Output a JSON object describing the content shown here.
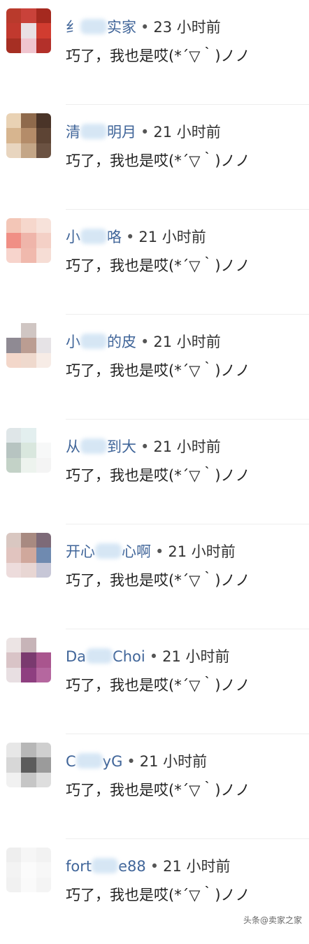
{
  "comments": [
    {
      "name_visible_start": "纟",
      "name_visible_end": "实家",
      "dot": "•",
      "time": "23 小时前",
      "text": "巧了，我也是哎(*´▽｀)ノノ",
      "avatar_colors": [
        "#b93a2c",
        "#c9423a",
        "#a5291f",
        "#c1392e",
        "#e9e0e4",
        "#d13c30",
        "#a62f23",
        "#f0c5cf",
        "#b3302a"
      ]
    },
    {
      "name_visible_start": "清",
      "name_visible_end": "明月",
      "dot": "•",
      "time": "21 小时前",
      "text": "巧了，我也是哎(*´▽｀)ノノ",
      "avatar_colors": [
        "#e9d2b4",
        "#8f6a4c",
        "#4a3428",
        "#d7b58f",
        "#b48c69",
        "#5d4434",
        "#e8d5bf",
        "#c4a687",
        "#6b5242"
      ]
    },
    {
      "name_visible_start": "小",
      "name_visible_end": "咯",
      "dot": "•",
      "time": "21 小时前",
      "text": "巧了，我也是哎(*´▽｀)ノノ",
      "avatar_colors": [
        "#f3c6b7",
        "#f6d7cc",
        "#f7e2da",
        "#f08f85",
        "#efb5aa",
        "#f4d0c6",
        "#f7d4cc",
        "#f0b9ad",
        "#f6ddd5"
      ]
    },
    {
      "name_visible_start": "小",
      "name_visible_end": "的皮",
      "dot": "•",
      "time": "21 小时前",
      "text": "巧了，我也是哎(*´▽｀)ノノ",
      "avatar_colors": [
        "#ffffff",
        "#d0c6c3",
        "#ffffff",
        "#8f8a93",
        "#bb9d92",
        "#e6e3e6",
        "#f3d7ca",
        "#efd9cd",
        "#f7ece6"
      ]
    },
    {
      "name_visible_start": "从",
      "name_visible_end": "到大",
      "dot": "•",
      "time": "21 小时前",
      "text": "巧了，我也是哎(*´▽｀)ノノ",
      "avatar_colors": [
        "#dfe6e8",
        "#e3efef",
        "#ffffff",
        "#b7c4c1",
        "#d9e7de",
        "#f7f8f8",
        "#c3d2c7",
        "#edf3ee",
        "#f4f4f4"
      ]
    },
    {
      "name_visible_start": "开心",
      "name_visible_end": "心啊",
      "dot": "•",
      "time": "21 小时前",
      "text": "巧了，我也是哎(*´▽｀)ノノ",
      "avatar_colors": [
        "#d9c7c1",
        "#a88a81",
        "#7d6a78",
        "#e1c4bf",
        "#d0a89c",
        "#6f8ab0",
        "#eddcdc",
        "#e8d6d3",
        "#c7c7d7"
      ]
    },
    {
      "name_visible_start": "Da",
      "name_visible_end": "Choi",
      "dot": "•",
      "time": "21 小时前",
      "text": "巧了，我也是哎(*´▽｀)ノノ",
      "avatar_colors": [
        "#ece4e4",
        "#c7b4b8",
        "#ffffff",
        "#d9c4c7",
        "#7a3a6f",
        "#a9558e",
        "#e8dfe2",
        "#8e3f80",
        "#b5679f"
      ]
    },
    {
      "name_visible_start": "C",
      "name_visible_end": "yG",
      "dot": "•",
      "time": "21 小时前",
      "text": "巧了，我也是哎(*´▽｀)ノノ",
      "avatar_colors": [
        "#e7e7e7",
        "#b7b7b7",
        "#cfcfcf",
        "#d7d7d7",
        "#5c5c5c",
        "#9b9b9b",
        "#f1f1f1",
        "#c6c6c6",
        "#dedede"
      ]
    },
    {
      "name_visible_start": "fort",
      "name_visible_end": "e88",
      "dot": "•",
      "time": "21 小时前",
      "text": "巧了，我也是哎(*´▽｀)ノノ",
      "avatar_colors": [
        "#eeeeee",
        "#f6f6f6",
        "#f2f2f2",
        "#f3f3f3",
        "#fbfbfb",
        "#f7f7f7",
        "#f1f1f1",
        "#fafafa",
        "#f4f4f4"
      ]
    }
  ],
  "watermark": {
    "brand": "头条",
    "at": "@",
    "author": "卖家之家"
  }
}
